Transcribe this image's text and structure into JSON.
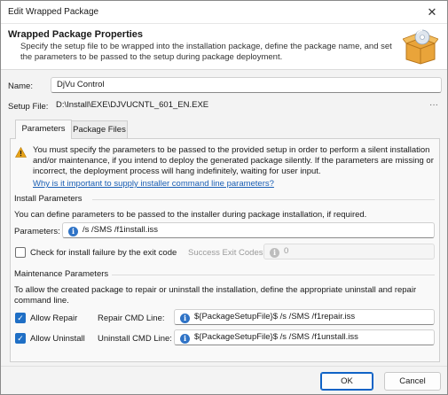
{
  "window": {
    "title": "Edit Wrapped Package",
    "close_glyph": "✕"
  },
  "header": {
    "title": "Wrapped Package Properties",
    "description": "Specify the setup file to be wrapped into the installation package, define the package name, and set the parameters to be passed to the setup during package deployment.",
    "icon": "package-box-icon"
  },
  "form": {
    "name_label": "Name:",
    "name_value": "DjVu Control",
    "setup_label": "Setup File:",
    "setup_value": "D:\\Install\\EXE\\DJVUCNTL_601_EN.EXE",
    "browse_label": "···"
  },
  "tabs": [
    {
      "label": "Parameters",
      "active": true
    },
    {
      "label": "Package Files",
      "active": false
    }
  ],
  "warning": {
    "text": "You must specify the parameters to be passed to the provided setup in order to perform a silent installation and/or maintenance, if you intend to deploy the generated package silently. If the parameters are missing or incorrect, the deployment process will hang indefinitely, waiting for user input.",
    "link": "Why is it important to supply installer command line parameters?"
  },
  "install": {
    "section_title": "Install Parameters",
    "description": "You can define parameters to be passed to the installer during package installation, if required.",
    "parameters_label": "Parameters:",
    "parameters_value": "/s /SMS /f1install.iss",
    "check_failure_label": "Check for install failure by the exit code",
    "check_failure_checked": false,
    "success_codes_label": "Success Exit Codes:",
    "success_codes_value": "0"
  },
  "maintenance": {
    "section_title": "Maintenance Parameters",
    "description": "To allow the created package to repair or uninstall the installation, define the appropriate uninstall and repair command line.",
    "allow_repair_label": "Allow Repair",
    "allow_repair_checked": true,
    "repair_cmd_label": "Repair CMD Line:",
    "repair_cmd_value": "${PackageSetupFile}$ /s /SMS /f1repair.iss",
    "allow_uninstall_label": "Allow Uninstall",
    "allow_uninstall_checked": true,
    "uninstall_cmd_label": "Uninstall CMD Line:",
    "uninstall_cmd_value": "${PackageSetupFile}$ /s /SMS /f1unstall.iss"
  },
  "footer": {
    "ok_label": "OK",
    "cancel_label": "Cancel"
  },
  "colors": {
    "accent": "#1f6fc5",
    "link": "#1a5fb4",
    "warning": "#e8a317"
  }
}
